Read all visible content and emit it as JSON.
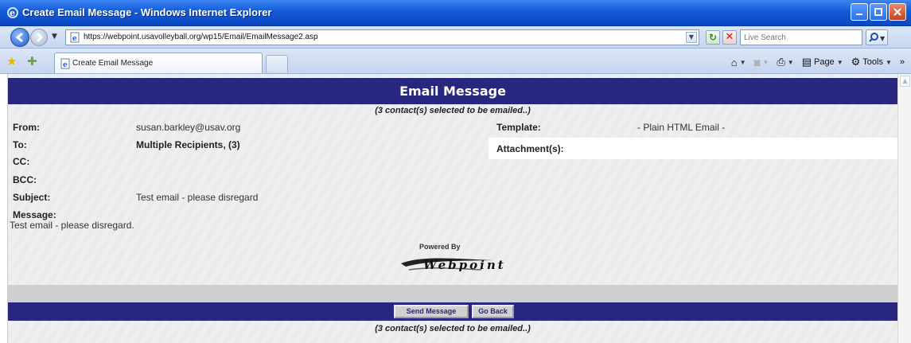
{
  "window": {
    "title": "Create Email Message - Windows Internet Explorer"
  },
  "address_bar": {
    "url": "https://webpoint.usavolleyball.org/wp15/Email/EmailMessage2.asp",
    "search_placeholder": "Live Search"
  },
  "tabs": [
    {
      "label": "Create Email Message"
    }
  ],
  "command_bar": {
    "page_label": "Page",
    "tools_label": "Tools"
  },
  "page": {
    "header": "Email Message",
    "selection_note": "(3 contact(s) selected to be emailed..)",
    "fields": {
      "from_label": "From:",
      "from_value": "susan.barkley@usav.org",
      "to_label": "To:",
      "to_value": "Multiple Recipients, (3)",
      "cc_label": "CC:",
      "bcc_label": "BCC:",
      "subject_label": "Subject:",
      "subject_value": "Test email - please disregard",
      "message_label": "Message:",
      "message_value": "Test email - please disregard.",
      "template_label": "Template:",
      "template_value": "- Plain HTML Email -",
      "attachments_label": "Attachment(s):"
    },
    "footer": {
      "powered_by": "Powered By",
      "logo_text": "Webpoint"
    },
    "buttons": {
      "send": "Send Message",
      "back": "Go Back"
    },
    "selection_note_bottom": "(3 contact(s) selected to be emailed..)"
  }
}
